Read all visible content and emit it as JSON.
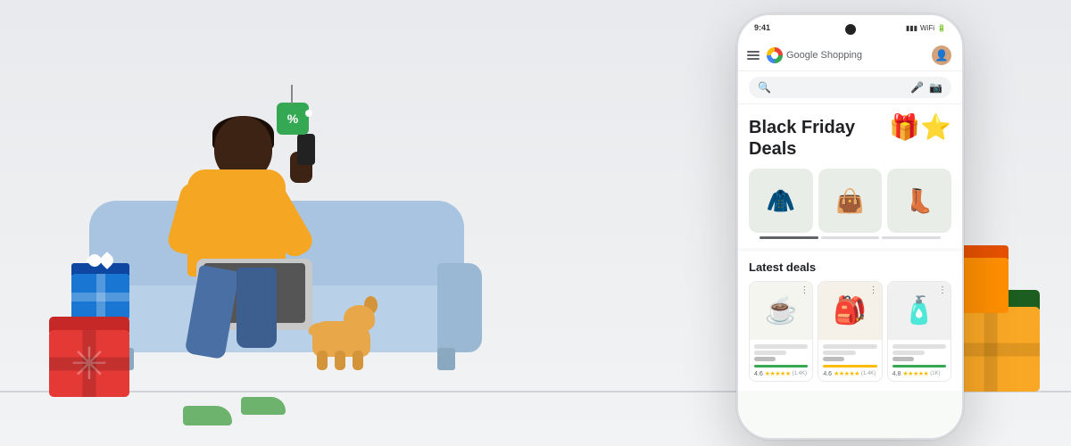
{
  "scene": {
    "background": "#f1f3f4"
  },
  "phone": {
    "header": {
      "menu_icon": "☰",
      "logo_text": "Google",
      "logo_sub": " Shopping",
      "avatar_label": "User avatar"
    },
    "search": {
      "placeholder": "Search"
    },
    "black_friday": {
      "title_line1": "Black Friday",
      "title_line2": "Deals",
      "emoji": "🎁⭐",
      "products": [
        "🧥",
        "👜",
        "👢"
      ]
    },
    "latest_deals": {
      "title": "Latest deals",
      "items": [
        {
          "emoji": "☕",
          "rating": "4.6",
          "stars": "★★★★★",
          "count": "(1.4K)",
          "bar_color": "green"
        },
        {
          "emoji": "🎒",
          "rating": "4.6",
          "stars": "★★★★★",
          "count": "(1.4K)",
          "bar_color": "yellow"
        },
        {
          "emoji": "🧴",
          "rating": "4.8",
          "stars": "★★★★★",
          "count": "(1K)",
          "bar_color": "green"
        }
      ]
    }
  },
  "gifts": {
    "red_label": "Red gift box",
    "blue_label": "Blue gift box",
    "green_label": "Green gift box",
    "gold_label": "Gold gift box"
  },
  "price_tag": {
    "symbol": "%",
    "label": "Price tag discount"
  },
  "person": {
    "label": "Person shopping"
  }
}
